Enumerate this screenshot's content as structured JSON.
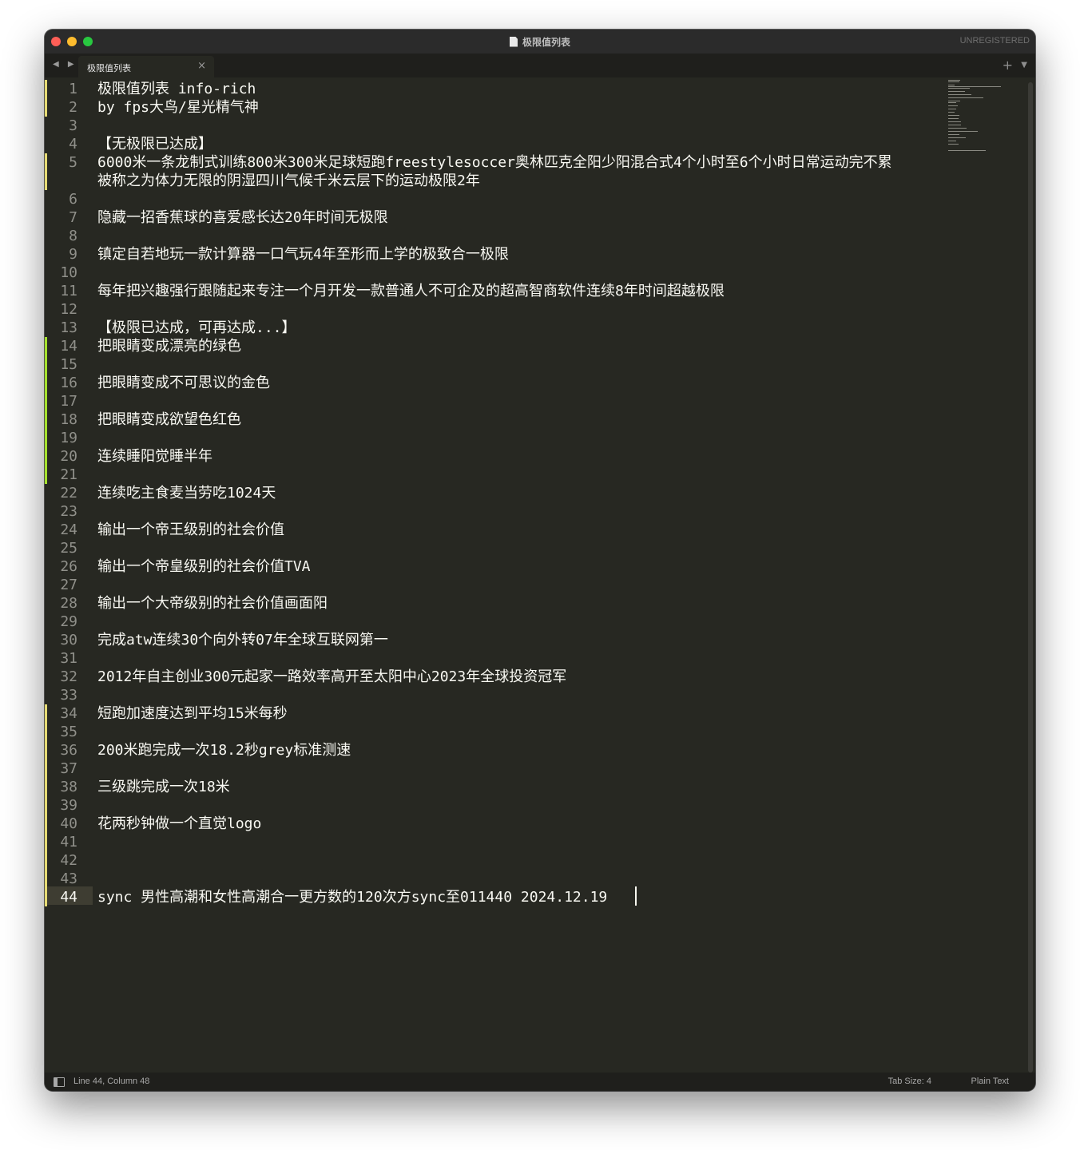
{
  "window": {
    "title": "极限值列表",
    "registration": "UNREGISTERED"
  },
  "tab": {
    "label": "极限值列表",
    "close_glyph": "×",
    "nav_glyphs": "◀ ▶",
    "new_tab_glyph": "+",
    "menu_glyph": "▼"
  },
  "editor": {
    "current_line": 44,
    "lines": [
      {
        "n": "1",
        "text": "极限值列表 info-rich"
      },
      {
        "n": "2",
        "text": "by fps大鸟/星光精气神"
      },
      {
        "n": "3",
        "text": ""
      },
      {
        "n": "4",
        "text": "【无极限已达成】"
      },
      {
        "n": "5",
        "text": "6000米一条龙制式训练800米300米足球短跑freestylesoccer奥林匹克全阳少阳混合式4个小时至6个小时日常运动完不累"
      },
      {
        "n": "",
        "text": "被称之为体力无限的阴湿四川气候千米云层下的运动极限2年"
      },
      {
        "n": "6",
        "text": ""
      },
      {
        "n": "7",
        "text": "隐藏一招香蕉球的喜爱感长达20年时间无极限"
      },
      {
        "n": "8",
        "text": ""
      },
      {
        "n": "9",
        "text": "镇定自若地玩一款计算器一口气玩4年至形而上学的极致合一极限"
      },
      {
        "n": "10",
        "text": ""
      },
      {
        "n": "11",
        "text": "每年把兴趣强行跟随起来专注一个月开发一款普通人不可企及的超高智商软件连续8年时间超越极限"
      },
      {
        "n": "12",
        "text": ""
      },
      {
        "n": "13",
        "text": "【极限已达成，可再达成...】"
      },
      {
        "n": "14",
        "text": "把眼睛变成漂亮的绿色"
      },
      {
        "n": "15",
        "text": ""
      },
      {
        "n": "16",
        "text": "把眼睛变成不可思议的金色"
      },
      {
        "n": "17",
        "text": ""
      },
      {
        "n": "18",
        "text": "把眼睛变成欲望色红色"
      },
      {
        "n": "19",
        "text": ""
      },
      {
        "n": "20",
        "text": "连续睡阳觉睡半年"
      },
      {
        "n": "21",
        "text": ""
      },
      {
        "n": "22",
        "text": "连续吃主食麦当劳吃1024天"
      },
      {
        "n": "23",
        "text": ""
      },
      {
        "n": "24",
        "text": "输出一个帝王级别的社会价值"
      },
      {
        "n": "25",
        "text": ""
      },
      {
        "n": "26",
        "text": "输出一个帝皇级别的社会价值TVA"
      },
      {
        "n": "27",
        "text": ""
      },
      {
        "n": "28",
        "text": "输出一个大帝级别的社会价值画面阳"
      },
      {
        "n": "29",
        "text": ""
      },
      {
        "n": "30",
        "text": "完成atw连续30个向外转07年全球互联网第一"
      },
      {
        "n": "31",
        "text": ""
      },
      {
        "n": "32",
        "text": "2012年自主创业300元起家一路效率高开至太阳中心2023年全球投资冠军"
      },
      {
        "n": "33",
        "text": ""
      },
      {
        "n": "34",
        "text": "短跑加速度达到平均15米每秒"
      },
      {
        "n": "35",
        "text": ""
      },
      {
        "n": "36",
        "text": "200米跑完成一次18.2秒grey标准测速"
      },
      {
        "n": "37",
        "text": ""
      },
      {
        "n": "38",
        "text": "三级跳完成一次18米"
      },
      {
        "n": "39",
        "text": ""
      },
      {
        "n": "40",
        "text": "花两秒钟做一个直觉logo"
      },
      {
        "n": "41",
        "text": ""
      },
      {
        "n": "42",
        "text": ""
      },
      {
        "n": "43",
        "text": ""
      },
      {
        "n": "44",
        "text": "sync 男性高潮和女性高潮合一更方数的120次方sync至011440 2024.12.19"
      }
    ]
  },
  "status": {
    "position": "Line 44, Column 48",
    "tab_size": "Tab Size: 4",
    "syntax": "Plain Text"
  },
  "colors": {
    "background": "#272822",
    "foreground": "#f8f8f2",
    "line_number": "#90908a",
    "modified_marker": "#e6db74",
    "added_marker": "#a6e22e"
  }
}
